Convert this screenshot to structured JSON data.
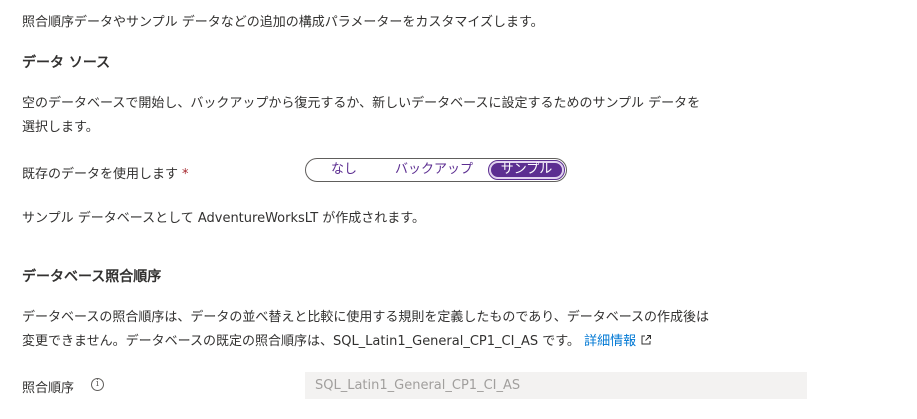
{
  "intro": "照合順序データやサンプル データなどの追加の構成パラメーターをカスタマイズします。",
  "data_source": {
    "heading": "データ ソース",
    "description_line1": "空のデータベースで開始し、バックアップから復元するか、新しいデータベースに設定するためのサンプル データを",
    "description_line2": "選択します。",
    "field_label": "既存のデータを使用します",
    "required_mark": "*",
    "options": [
      "なし",
      "バックアップ",
      "サンプル"
    ],
    "selected_option": "サンプル",
    "note": "サンプル データベースとして AdventureWorksLT が作成されます。"
  },
  "collation": {
    "heading": "データベース照合順序",
    "description_line1": "データベースの照合順序は、データの並べ替えと比較に使用する規則を定義したものであり、データベースの作成後は",
    "description_line2": "変更できません。データベースの既定の照合順序は、SQL_Latin1_General_CP1_CI_AS です。",
    "learn_more": "詳細情報",
    "field_label": "照合順序",
    "info_icon_glyph": "i",
    "value": "SQL_Latin1_General_CP1_CI_AS"
  },
  "colors": {
    "accent": "#5c2e91",
    "link": "#0078d4",
    "required": "#a4262c",
    "disabled_bg": "#f3f2f1"
  }
}
